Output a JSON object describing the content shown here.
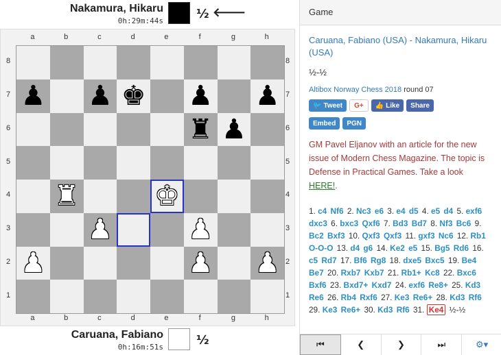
{
  "top_player": {
    "name": "Nakamura, Hikaru",
    "clock": "0h:29m:44s",
    "score": "½",
    "turn_arrow": "🡐"
  },
  "bottom_player": {
    "name": "Caruana, Fabiano",
    "clock": "0h:16m:51s",
    "score": "½"
  },
  "board": {
    "files": [
      "a",
      "b",
      "c",
      "d",
      "e",
      "f",
      "g",
      "h"
    ],
    "ranks": [
      "8",
      "7",
      "6",
      "5",
      "4",
      "3",
      "2",
      "1"
    ],
    "light_color": "#efefef",
    "dark_color": "#a9a9a9",
    "highlight_color": "#2733c4",
    "highlight_squares": [
      "e4",
      "d3"
    ],
    "pieces": [
      {
        "square": "a7",
        "glyph": "♟",
        "side": "b",
        "name": "black-pawn-icon"
      },
      {
        "square": "c7",
        "glyph": "♟",
        "side": "b",
        "name": "black-pawn-icon"
      },
      {
        "square": "d7",
        "glyph": "♚",
        "side": "b",
        "name": "black-king-icon"
      },
      {
        "square": "f7",
        "glyph": "♟",
        "side": "b",
        "name": "black-pawn-icon"
      },
      {
        "square": "h7",
        "glyph": "♟",
        "side": "b",
        "name": "black-pawn-icon"
      },
      {
        "square": "f6",
        "glyph": "♜",
        "side": "b",
        "name": "black-rook-icon"
      },
      {
        "square": "g6",
        "glyph": "♟",
        "side": "b",
        "name": "black-pawn-icon"
      },
      {
        "square": "b4",
        "glyph": "♜",
        "side": "w",
        "name": "white-rook-icon"
      },
      {
        "square": "e4",
        "glyph": "♚",
        "side": "w",
        "name": "white-king-icon"
      },
      {
        "square": "c3",
        "glyph": "♟",
        "side": "w",
        "name": "white-pawn-icon"
      },
      {
        "square": "f3",
        "glyph": "♟",
        "side": "w",
        "name": "white-pawn-icon"
      },
      {
        "square": "a2",
        "glyph": "♟",
        "side": "w",
        "name": "white-pawn-icon"
      },
      {
        "square": "f2",
        "glyph": "♟",
        "side": "w",
        "name": "white-pawn-icon"
      },
      {
        "square": "h2",
        "glyph": "♟",
        "side": "w",
        "name": "white-pawn-icon"
      }
    ]
  },
  "panel": {
    "heading": "Game",
    "players": "Caruana, Fabiano (USA) - Nakamura, Hikaru (USA)",
    "result": "½-½",
    "event": "Altibox Norway Chess 2018",
    "round": "round 07",
    "share": {
      "tweet": "Tweet",
      "gplus": "G+",
      "like": "Like",
      "share": "Share",
      "embed": "Embed",
      "pgn": "PGN"
    },
    "promo_text": "GM Pavel Eljanov with an article for the new issue of Modern Chess Magazine. The topic is Defense in Practical Games. Take a look",
    "promo_link": "HERE!",
    "promo_end": ".",
    "moves": [
      [
        "1.",
        "c4",
        "Nf6"
      ],
      [
        "2.",
        "Nc3",
        "e6"
      ],
      [
        "3.",
        "e4",
        "d5"
      ],
      [
        "4.",
        "e5",
        "d4"
      ],
      [
        "5.",
        "exf6",
        "dxc3"
      ],
      [
        "6.",
        "bxc3",
        "Qxf6"
      ],
      [
        "7.",
        "Bd3",
        "Bd7"
      ],
      [
        "8.",
        "Nf3",
        "Bc6"
      ],
      [
        "9.",
        "Bc2",
        "Bxf3"
      ],
      [
        "10.",
        "Qxf3",
        "Qxf3"
      ],
      [
        "11.",
        "gxf3",
        "Nc6"
      ],
      [
        "12.",
        "Rb1",
        "O-O-O"
      ],
      [
        "13.",
        "d4",
        "g6"
      ],
      [
        "14.",
        "Ke2",
        "e5"
      ],
      [
        "15.",
        "Bg5",
        "Rd6"
      ],
      [
        "16.",
        "c5",
        "Rd7"
      ],
      [
        "17.",
        "Bf6",
        "Rg8"
      ],
      [
        "18.",
        "dxe5",
        "Bxc5"
      ],
      [
        "19.",
        "Be4",
        "Be7"
      ],
      [
        "20.",
        "Rxb7",
        "Kxb7"
      ],
      [
        "21.",
        "Rb1+",
        "Kc8"
      ],
      [
        "22.",
        "Bxc6",
        "Bxf6"
      ],
      [
        "23.",
        "Bxd7+",
        "Kxd7"
      ],
      [
        "24.",
        "exf6",
        "Re8+"
      ],
      [
        "25.",
        "Kd3",
        "Re6"
      ],
      [
        "26.",
        "Rb4",
        "Rxf6"
      ],
      [
        "27.",
        "Ke3",
        "Re6+"
      ],
      [
        "28.",
        "Kd3",
        "Rf6"
      ],
      [
        "29.",
        "Ke3",
        "Re6+"
      ],
      [
        "30.",
        "Kd3",
        "Rf6"
      ],
      [
        "31.",
        "Ke4",
        ""
      ]
    ],
    "final_result": "½-½",
    "nav": {
      "first": "⏮",
      "prev": "❮",
      "next": "❯",
      "last": "⏭",
      "settings": "⚙▾"
    }
  }
}
